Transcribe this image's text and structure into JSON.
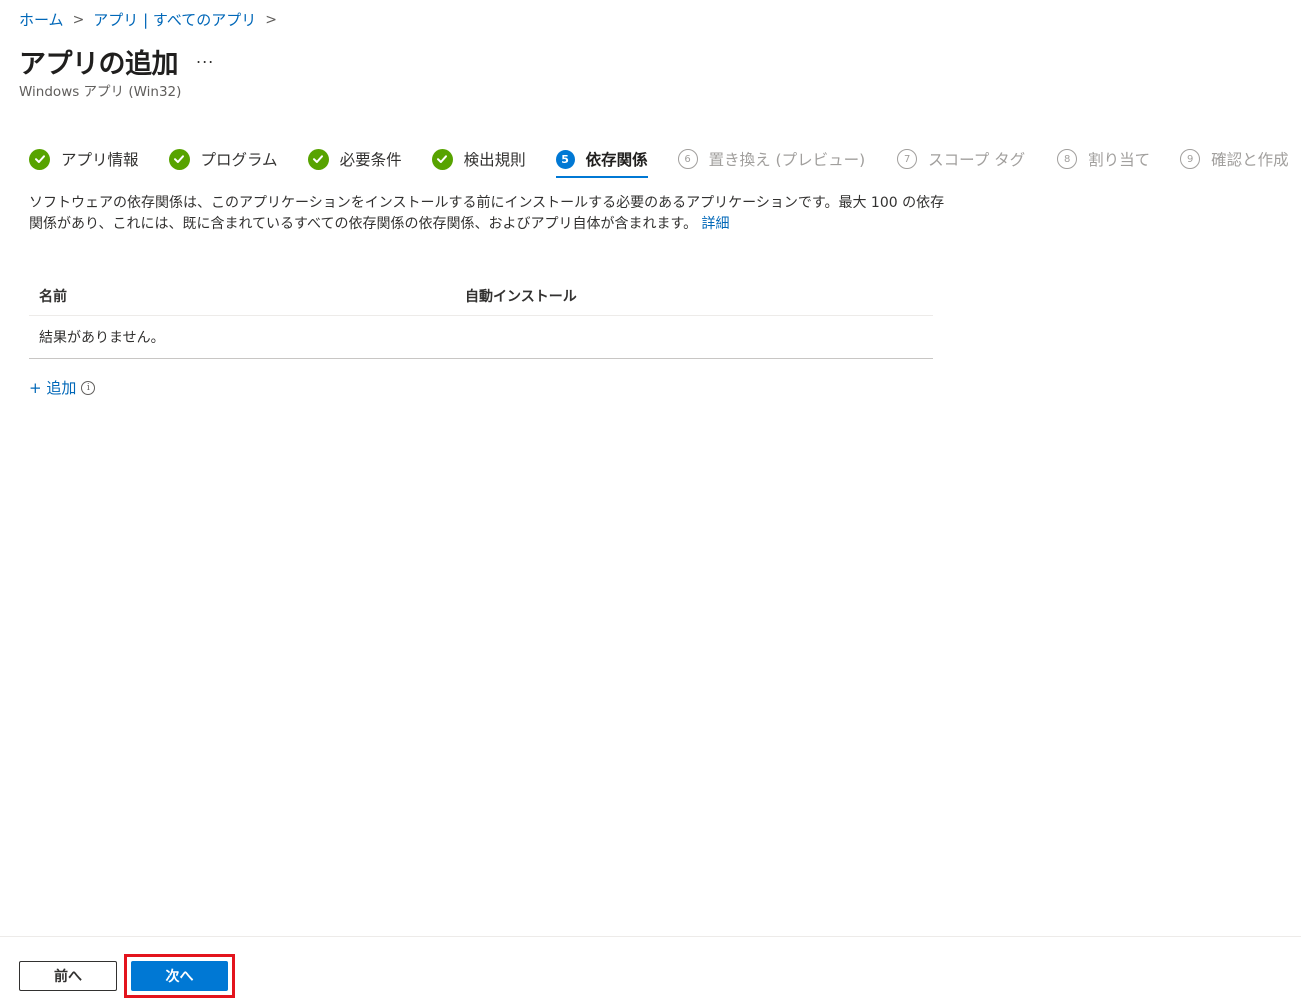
{
  "breadcrumb": {
    "items": [
      "ホーム",
      "アプリ | すべてのアプリ"
    ],
    "separator": ">"
  },
  "header": {
    "title": "アプリの追加",
    "more": "...",
    "subtitle": "Windows アプリ (Win32)"
  },
  "steps": [
    {
      "label": "アプリ情報",
      "state": "done"
    },
    {
      "label": "プログラム",
      "state": "done"
    },
    {
      "label": "必要条件",
      "state": "done"
    },
    {
      "label": "検出規則",
      "state": "done"
    },
    {
      "number": "5",
      "label": "依存関係",
      "state": "current"
    },
    {
      "number": "6",
      "label": "置き換え (プレビュー)",
      "state": "future"
    },
    {
      "number": "7",
      "label": "スコープ タグ",
      "state": "future"
    },
    {
      "number": "8",
      "label": "割り当て",
      "state": "future"
    },
    {
      "number": "9",
      "label": "確認と作成",
      "state": "future"
    }
  ],
  "description": {
    "text": "ソフトウェアの依存関係は、このアプリケーションをインストールする前にインストールする必要のあるアプリケーションです。最大 100 の依存関係があり、これには、既に含まれているすべての依存関係の依存関係、およびアプリ自体が含まれます。",
    "link": "詳細"
  },
  "table": {
    "columns": [
      "名前",
      "自動インストール"
    ],
    "empty_message": "結果がありません。"
  },
  "add": {
    "label": "+ 追加",
    "info": "i"
  },
  "footer": {
    "prev_label": "前へ",
    "next_label": "次へ"
  },
  "colors": {
    "accent": "#0078d4",
    "link": "#0067b8",
    "done": "#57a300",
    "highlight": "#e3141d"
  }
}
